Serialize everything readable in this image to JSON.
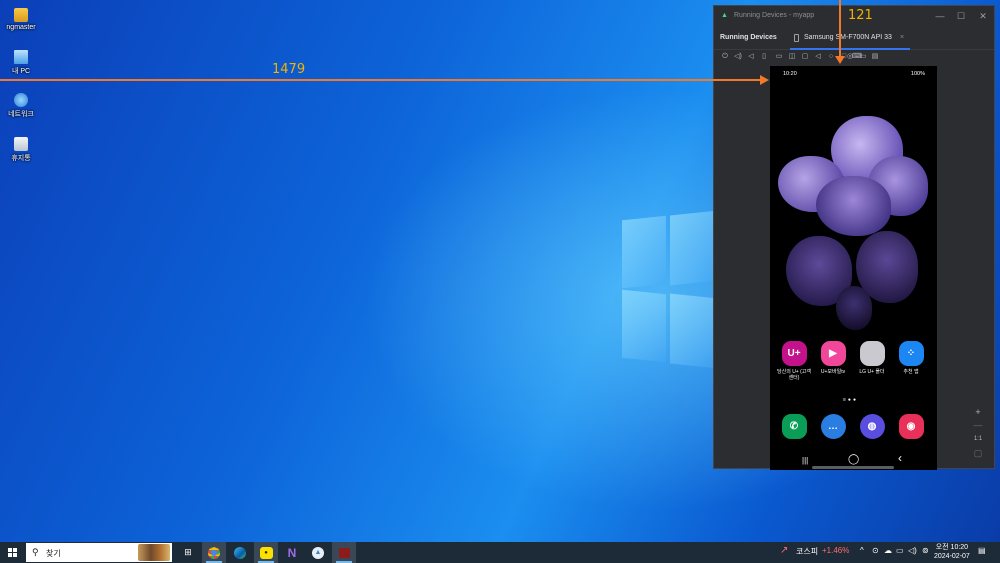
{
  "desktop": {
    "icons": [
      {
        "label": "ngmaster"
      },
      {
        "label": "내 PC"
      },
      {
        "label": "네트워크"
      },
      {
        "label": "휴지통"
      }
    ]
  },
  "annotations": {
    "horizontal_value": "1479",
    "vertical_value": "121"
  },
  "running_devices": {
    "window_title": "Running Devices - myapp",
    "panel_title": "Running Devices",
    "device_tab": "Samsung SM-F700N API 33",
    "tab_close": "×",
    "window_controls": {
      "minimize": "—",
      "maximize": "☐",
      "close": "✕"
    },
    "zoom_in": "+",
    "zoom_out": "—",
    "zoom_actual": "1:1"
  },
  "phone": {
    "status_time": "10:20",
    "status_battery": "100%",
    "apps": [
      {
        "label": "당신의 U+ (고객센터)",
        "glyph": "U+",
        "color": "#c4128c"
      },
      {
        "label": "U+모바일tv",
        "glyph": "▶",
        "color": "#f0479a"
      },
      {
        "label": "LG U+ 폴더",
        "glyph": "",
        "color": "#c9c9cf"
      },
      {
        "label": "추천 앱",
        "glyph": "⁘",
        "color": "#1c86f2"
      }
    ],
    "dock": [
      {
        "name": "phone-app",
        "glyph": "✆",
        "color": "#0a9d58"
      },
      {
        "name": "messages-app",
        "glyph": "…",
        "color": "#2a7de1"
      },
      {
        "name": "internet-app",
        "glyph": "◍",
        "color": "#5a4ee0"
      },
      {
        "name": "camera-app",
        "glyph": "◉",
        "color": "#e8305b"
      }
    ],
    "nav": {
      "recents": "|||",
      "home": "◯",
      "back": "‹"
    }
  },
  "taskbar": {
    "search_placeholder": "찾기",
    "stock_name": "코스피",
    "stock_change": "+1.46%",
    "clock_time": "오전 10:20",
    "clock_date": "2024-02-07",
    "colors": {
      "accent": "#76b9ed",
      "stock_up": "#ff6b6b"
    }
  }
}
